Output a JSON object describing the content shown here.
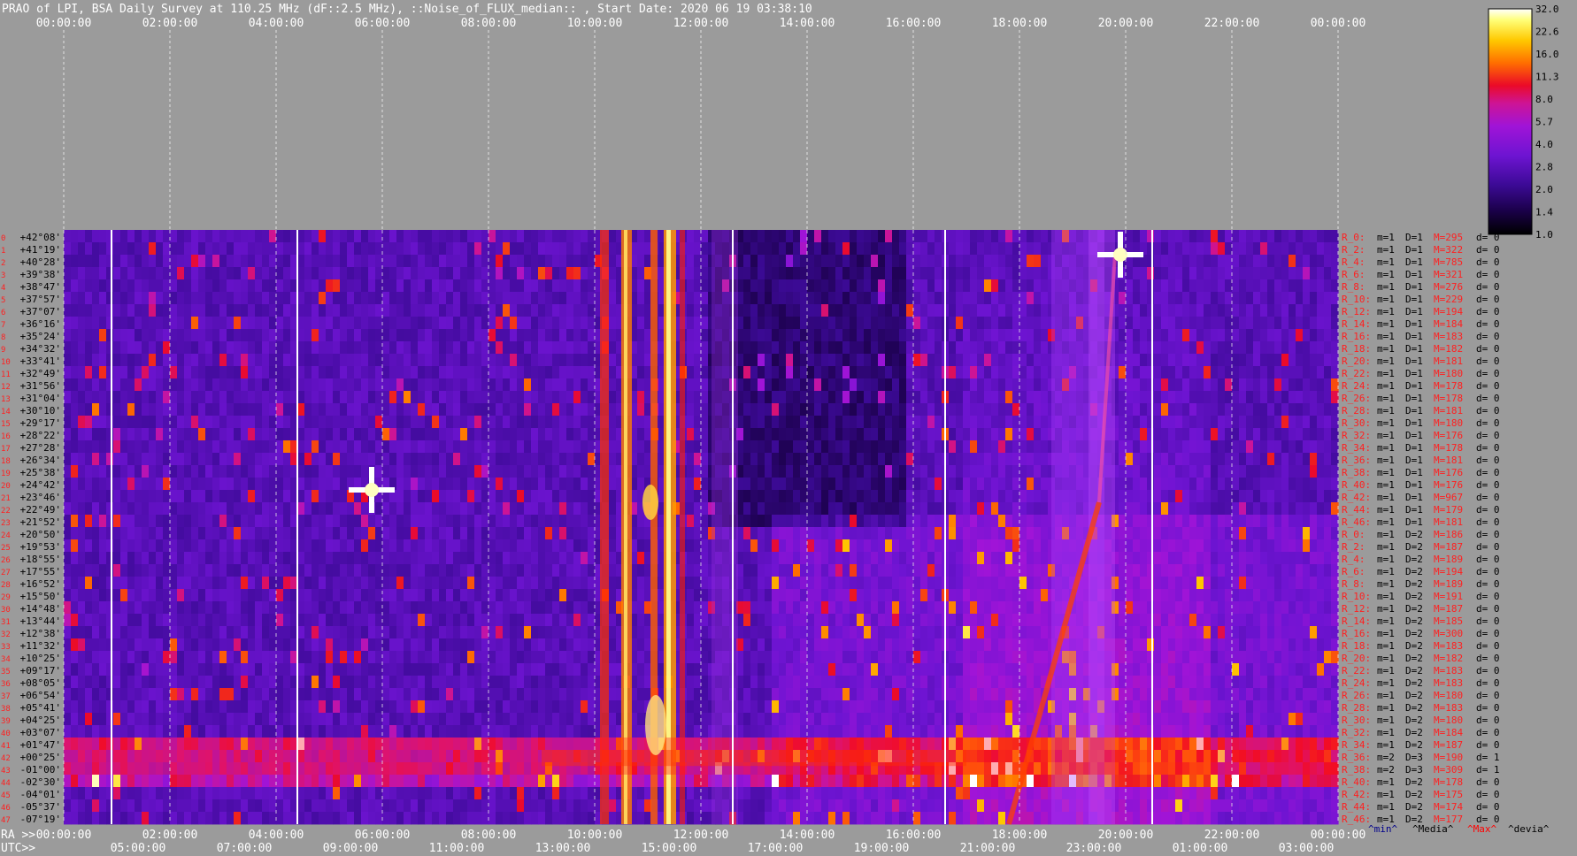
{
  "title": "PRAO of LPI, BSA Daily Survey at 110.25 MHz (dF::2.5 MHz), ::Noise_of_FLUX_median:: , Start Date: 2020 06 19 03:38:10",
  "chart_data": {
    "type": "heatmap",
    "title": "PRAO of LPI, BSA Daily Survey at 110.25 MHz (dF::2.5 MHz), ::Noise_of_FLUX_median:: , Start Date: 2020 06 19 03:38:10",
    "xlabel_ra": "RA >>",
    "xlabel_utc": "UTC>>",
    "ra_ticks": [
      "00:00:00",
      "02:00:00",
      "04:00:00",
      "06:00:00",
      "08:00:00",
      "10:00:00",
      "12:00:00",
      "14:00:00",
      "16:00:00",
      "18:00:00",
      "20:00:00",
      "22:00:00",
      "00:00:00"
    ],
    "utc_ticks": [
      "05:00:00",
      "07:00:00",
      "09:00:00",
      "11:00:00",
      "13:00:00",
      "15:00:00",
      "17:00:00",
      "19:00:00",
      "21:00:00",
      "23:00:00",
      "01:00:00",
      "03:00:00"
    ],
    "dec_labels": [
      "+42°08'",
      "+41°19'",
      "+40°28'",
      "+39°38'",
      "+38°47'",
      "+37°57'",
      "+37°07'",
      "+36°16'",
      "+35°24'",
      "+34°32'",
      "+33°41'",
      "+32°49'",
      "+31°56'",
      "+31°04'",
      "+30°10'",
      "+29°17'",
      "+28°22'",
      "+27°28'",
      "+26°34'",
      "+25°38'",
      "+24°42'",
      "+23°46'",
      "+22°49'",
      "+21°52'",
      "+20°50'",
      "+19°53'",
      "+18°55'",
      "+17°55'",
      "+16°52'",
      "+15°50'",
      "+14°48'",
      "+13°44'",
      "+12°38'",
      "+11°32'",
      "+10°25'",
      "+09°17'",
      "+08°05'",
      "+06°54'",
      "+05°41'",
      "+04°25'",
      "+03°07'",
      "+01°47'",
      "+00°25'",
      "-01°00'",
      "-02°30'",
      "-04°01'",
      "-05°37'",
      "-07°19'"
    ],
    "beam_rows": [
      {
        "r": "R_0:",
        "m": "m=1",
        "D": "D=1",
        "M": "M=295",
        "d": "d= 0"
      },
      {
        "r": "R_2:",
        "m": "m=1",
        "D": "D=1",
        "M": "M=322",
        "d": "d= 0"
      },
      {
        "r": "R_4:",
        "m": "m=1",
        "D": "D=1",
        "M": "M=785",
        "d": "d= 0"
      },
      {
        "r": "R_6:",
        "m": "m=1",
        "D": "D=1",
        "M": "M=321",
        "d": "d= 0"
      },
      {
        "r": "R_8:",
        "m": "m=1",
        "D": "D=1",
        "M": "M=276",
        "d": "d= 0"
      },
      {
        "r": "R_10:",
        "m": "m=1",
        "D": "D=1",
        "M": "M=229",
        "d": "d= 0"
      },
      {
        "r": "R_12:",
        "m": "m=1",
        "D": "D=1",
        "M": "M=194",
        "d": "d= 0"
      },
      {
        "r": "R_14:",
        "m": "m=1",
        "D": "D=1",
        "M": "M=184",
        "d": "d= 0"
      },
      {
        "r": "R_16:",
        "m": "m=1",
        "D": "D=1",
        "M": "M=183",
        "d": "d= 0"
      },
      {
        "r": "R_18:",
        "m": "m=1",
        "D": "D=1",
        "M": "M=182",
        "d": "d= 0"
      },
      {
        "r": "R_20:",
        "m": "m=1",
        "D": "D=1",
        "M": "M=181",
        "d": "d= 0"
      },
      {
        "r": "R_22:",
        "m": "m=1",
        "D": "D=1",
        "M": "M=180",
        "d": "d= 0"
      },
      {
        "r": "R_24:",
        "m": "m=1",
        "D": "D=1",
        "M": "M=178",
        "d": "d= 0"
      },
      {
        "r": "R_26:",
        "m": "m=1",
        "D": "D=1",
        "M": "M=178",
        "d": "d= 0"
      },
      {
        "r": "R_28:",
        "m": "m=1",
        "D": "D=1",
        "M": "M=181",
        "d": "d= 0"
      },
      {
        "r": "R_30:",
        "m": "m=1",
        "D": "D=1",
        "M": "M=180",
        "d": "d= 0"
      },
      {
        "r": "R_32:",
        "m": "m=1",
        "D": "D=1",
        "M": "M=176",
        "d": "d= 0"
      },
      {
        "r": "R_34:",
        "m": "m=1",
        "D": "D=1",
        "M": "M=178",
        "d": "d= 0"
      },
      {
        "r": "R_36:",
        "m": "m=1",
        "D": "D=1",
        "M": "M=181",
        "d": "d= 0"
      },
      {
        "r": "R_38:",
        "m": "m=1",
        "D": "D=1",
        "M": "M=176",
        "d": "d= 0"
      },
      {
        "r": "R_40:",
        "m": "m=1",
        "D": "D=1",
        "M": "M=176",
        "d": "d= 0"
      },
      {
        "r": "R_42:",
        "m": "m=1",
        "D": "D=1",
        "M": "M=967",
        "d": "d= 0"
      },
      {
        "r": "R_44:",
        "m": "m=1",
        "D": "D=1",
        "M": "M=179",
        "d": "d= 0"
      },
      {
        "r": "R_46:",
        "m": "m=1",
        "D": "D=1",
        "M": "M=181",
        "d": "d= 0"
      },
      {
        "r": "R_0:",
        "m": "m=1",
        "D": "D=2",
        "M": "M=186",
        "d": "d= 0"
      },
      {
        "r": "R_2:",
        "m": "m=1",
        "D": "D=2",
        "M": "M=187",
        "d": "d= 0"
      },
      {
        "r": "R_4:",
        "m": "m=1",
        "D": "D=2",
        "M": "M=189",
        "d": "d= 0"
      },
      {
        "r": "R_6:",
        "m": "m=1",
        "D": "D=2",
        "M": "M=194",
        "d": "d= 0"
      },
      {
        "r": "R_8:",
        "m": "m=1",
        "D": "D=2",
        "M": "M=189",
        "d": "d= 0"
      },
      {
        "r": "R_10:",
        "m": "m=1",
        "D": "D=2",
        "M": "M=191",
        "d": "d= 0"
      },
      {
        "r": "R_12:",
        "m": "m=1",
        "D": "D=2",
        "M": "M=187",
        "d": "d= 0"
      },
      {
        "r": "R_14:",
        "m": "m=1",
        "D": "D=2",
        "M": "M=185",
        "d": "d= 0"
      },
      {
        "r": "R_16:",
        "m": "m=1",
        "D": "D=2",
        "M": "M=300",
        "d": "d= 0"
      },
      {
        "r": "R_18:",
        "m": "m=1",
        "D": "D=2",
        "M": "M=183",
        "d": "d= 0"
      },
      {
        "r": "R_20:",
        "m": "m=1",
        "D": "D=2",
        "M": "M=182",
        "d": "d= 0"
      },
      {
        "r": "R_22:",
        "m": "m=1",
        "D": "D=2",
        "M": "M=183",
        "d": "d= 0"
      },
      {
        "r": "R_24:",
        "m": "m=1",
        "D": "D=2",
        "M": "M=183",
        "d": "d= 0"
      },
      {
        "r": "R_26:",
        "m": "m=1",
        "D": "D=2",
        "M": "M=180",
        "d": "d= 0"
      },
      {
        "r": "R_28:",
        "m": "m=1",
        "D": "D=2",
        "M": "M=183",
        "d": "d= 0"
      },
      {
        "r": "R_30:",
        "m": "m=1",
        "D": "D=2",
        "M": "M=180",
        "d": "d= 0"
      },
      {
        "r": "R_32:",
        "m": "m=1",
        "D": "D=2",
        "M": "M=184",
        "d": "d= 0"
      },
      {
        "r": "R_34:",
        "m": "m=1",
        "D": "D=2",
        "M": "M=187",
        "d": "d= 0"
      },
      {
        "r": "R_36:",
        "m": "m=2",
        "D": "D=3",
        "M": "M=190",
        "d": "d= 1"
      },
      {
        "r": "R_38:",
        "m": "m=2",
        "D": "D=3",
        "M": "M=309",
        "d": "d= 1"
      },
      {
        "r": "R_40:",
        "m": "m=1",
        "D": "D=2",
        "M": "M=178",
        "d": "d= 0"
      },
      {
        "r": "R_42:",
        "m": "m=1",
        "D": "D=2",
        "M": "M=175",
        "d": "d= 0"
      },
      {
        "r": "R_44:",
        "m": "m=1",
        "D": "D=2",
        "M": "M=174",
        "d": "d= 0"
      },
      {
        "r": "R_46:",
        "m": "m=1",
        "D": "D=2",
        "M": "M=177",
        "d": "d= 0"
      }
    ],
    "footer_legend": [
      "^min^",
      "^Media^",
      "^Max^",
      "^devia^"
    ],
    "colorbar": {
      "labels": [
        "32.0",
        "22.6",
        "16.0",
        "11.3",
        "8.0",
        "5.7",
        "4.0",
        "2.8",
        "2.0",
        "1.4",
        "1.0"
      ],
      "scale": "log",
      "range": [
        1.0,
        32.0
      ]
    },
    "colors": {
      "background": "#9b9b9b",
      "text": "#ffffff",
      "beam_label": "#ff2020",
      "beam_value": "#000000",
      "min_legend": "#00008b",
      "max_legend": "#ff0000"
    }
  }
}
